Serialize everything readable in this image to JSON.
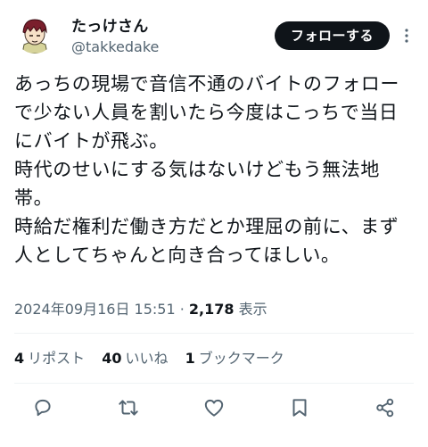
{
  "author": {
    "display_name": "たっけさん",
    "handle": "@takkedake"
  },
  "follow_label": "フォローする",
  "tweet_lines": [
    "あっちの現場で音信不通のバイトのフォロー",
    "で少ない人員を割いたら今度はこっちで当日",
    "にバイトが飛ぶ。",
    "時代のせいにする気はないけどもう無法地",
    "帯。",
    "時給だ権利だ働き方だとか理屈の前に、まず",
    "人としてちゃんと向き合ってほしい。"
  ],
  "meta": {
    "timestamp": "2024年09月16日 15:51",
    "separator": " · ",
    "views_count": "2,178",
    "views_label": " 表示"
  },
  "stats": {
    "reposts_count": "4",
    "reposts_label": "リポスト",
    "likes_count": "40",
    "likes_label": "いいね",
    "bookmarks_count": "1",
    "bookmarks_label": "ブックマーク"
  },
  "colors": {
    "text": "#0f1419",
    "muted": "#536471",
    "divider": "#eff3f4",
    "follow_bg": "#0f1419"
  },
  "icons": [
    "avatar-illustration",
    "more-icon",
    "reply-icon",
    "repost-icon",
    "like-icon",
    "bookmark-icon",
    "share-icon"
  ]
}
